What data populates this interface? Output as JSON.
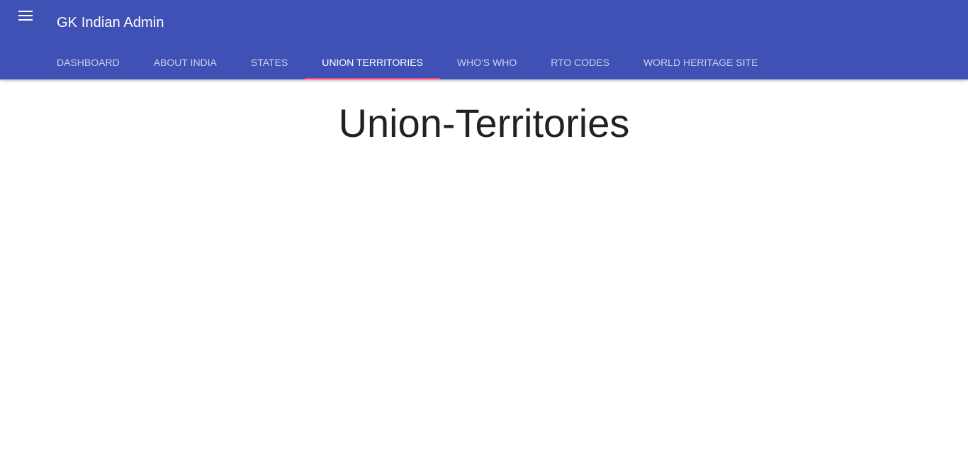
{
  "appbar": {
    "menu_icon": "hamburger-menu-icon",
    "title": "GK Indian Admin",
    "color": "#3f51b5",
    "indicator_color": "#ff4081"
  },
  "tabs": [
    {
      "label": "DASHBOARD",
      "active": false
    },
    {
      "label": "ABOUT INDIA",
      "active": false
    },
    {
      "label": "STATES",
      "active": false
    },
    {
      "label": "UNION TERRITORIES",
      "active": true
    },
    {
      "label": "WHO'S WHO",
      "active": false
    },
    {
      "label": "RTO CODES",
      "active": false
    },
    {
      "label": "WORLD HERITAGE SITE",
      "active": false
    }
  ],
  "main": {
    "title": "Union-Territories"
  }
}
